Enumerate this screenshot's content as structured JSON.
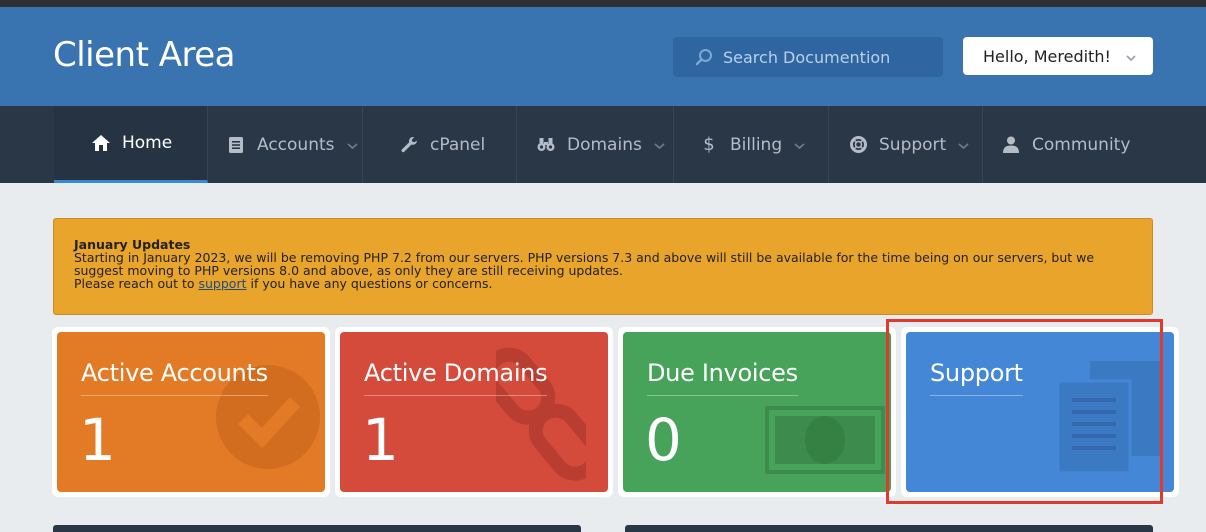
{
  "header": {
    "brand": "Client Area",
    "search_placeholder": "Search Documention",
    "user_greeting": "Hello, Meredith!"
  },
  "nav": {
    "items": [
      {
        "label": "Home",
        "icon": "home-icon",
        "active": true
      },
      {
        "label": "Accounts",
        "icon": "document-icon",
        "dropdown": true
      },
      {
        "label": "cPanel",
        "icon": "wrench-icon"
      },
      {
        "label": "Domains",
        "icon": "binoculars-icon",
        "dropdown": true
      },
      {
        "label": "Billing",
        "icon": "dollar-icon",
        "dropdown": true
      },
      {
        "label": "Support",
        "icon": "lifebuoy-icon",
        "dropdown": true
      },
      {
        "label": "Community",
        "icon": "user-icon"
      }
    ]
  },
  "alert": {
    "title": "January Updates",
    "line1": "Starting in January 2023, we will be removing PHP 7.2 from our servers. PHP versions 7.3 and above will still be available for the time being on our servers, but we suggest moving to PHP versions 8.0 and above, as only they are still receiving updates.",
    "line2_before": "Please reach out to ",
    "line2_link": "support",
    "line2_after": " if you have any questions or concerns."
  },
  "tiles": [
    {
      "label": "Active Accounts",
      "value": "1",
      "color": "#e37a25",
      "icon": "check-circle-icon"
    },
    {
      "label": "Active Domains",
      "value": "1",
      "color": "#d44b3b",
      "icon": "chain-link-icon"
    },
    {
      "label": "Due Invoices",
      "value": "0",
      "color": "#47a25a",
      "icon": "money-bill-icon"
    },
    {
      "label": "Support",
      "value": "",
      "color": "#4487d6",
      "icon": "documents-icon"
    }
  ],
  "colors": {
    "header": "#3a74b0",
    "nav": "#2a3747",
    "alert": "#e9a42b",
    "highlight": "#e0392d"
  }
}
